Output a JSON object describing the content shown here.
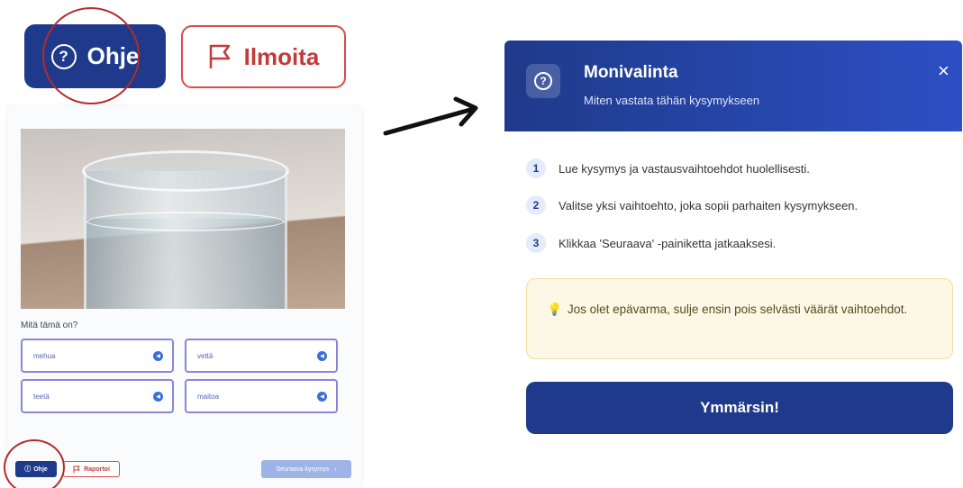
{
  "zoom": {
    "help_label": "Ohje",
    "report_label": "Ilmoita"
  },
  "quiz": {
    "question": "Mitä tämä on?",
    "options": [
      "mehua",
      "vettä",
      "teetä",
      "maitoa"
    ],
    "help_label": "Ohje",
    "report_label": "Raportoi",
    "next_label": "Seuraava kysymys"
  },
  "modal": {
    "title": "Monivalinta",
    "subtitle": "Miten vastata tähän kysymykseen",
    "close": "×",
    "steps": [
      {
        "num": "1",
        "text": "Lue kysymys ja vastausvaihtoehdot huolellisesti."
      },
      {
        "num": "2",
        "text": "Valitse yksi vaihtoehto, joka sopii parhaiten kysymykseen."
      },
      {
        "num": "3",
        "text": "Klikkaa 'Seuraava' -painiketta jatkaaksesi."
      }
    ],
    "tip": "Jos olet epävarma, sulje ensin pois selvästi väärät vaihtoehdot.",
    "confirm_label": "Ymmärsin!"
  },
  "colors": {
    "primary": "#1f3a8a",
    "report_red": "#d94a4a",
    "annotation_red": "#b32b2b",
    "tip_bg": "#fdf8e6"
  }
}
